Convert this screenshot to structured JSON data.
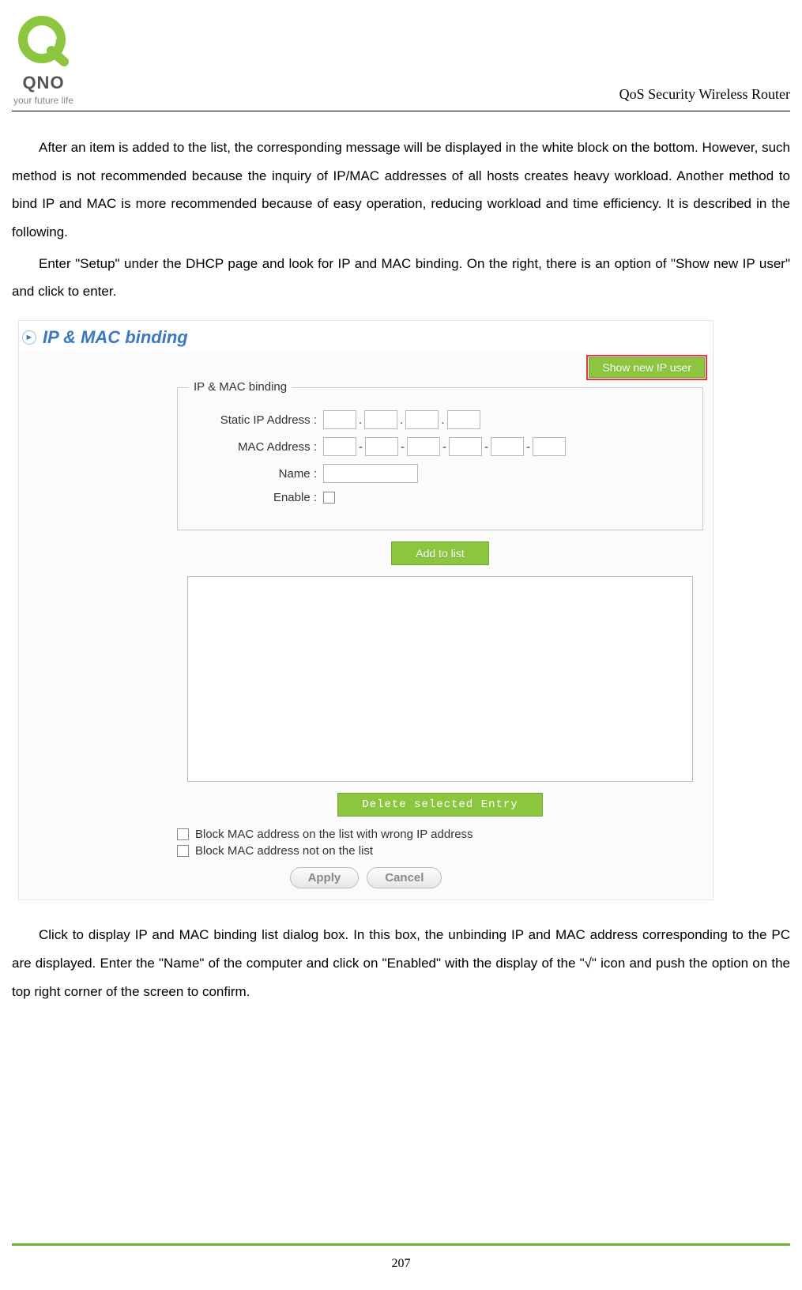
{
  "header": {
    "logo_brand": "QNO",
    "logo_tagline": "your future life",
    "doc_title": "QoS Security Wireless Router"
  },
  "paragraphs": {
    "p1": "After an item is added to the list, the corresponding message will be displayed in the white block on the bottom. However, such method is not recommended because the inquiry of IP/MAC addresses of all hosts creates heavy workload. Another method to bind IP and MAC is more recommended because of easy operation, reducing workload and time efficiency. It is described in the following.",
    "p2": "Enter \"Setup\" under the DHCP page and look for IP and MAC binding. On the right, there is an option of \"Show new IP user\" and click to enter.",
    "p3": "Click to display IP and MAC binding list dialog box. In this box, the unbinding IP and MAC address corresponding to the PC are displayed. Enter the \"Name\" of the computer and click on \"Enabled\" with the display of the \"√\" icon and push the option on the top right corner of the screen to confirm."
  },
  "ui": {
    "section_title": "IP & MAC binding",
    "show_new_ip_btn": "Show new IP user",
    "fieldset_legend": "IP & MAC binding",
    "labels": {
      "static_ip": "Static IP Address :",
      "mac": "MAC Address :",
      "name": "Name :",
      "enable": "Enable :"
    },
    "add_btn": "Add to list",
    "delete_btn": "Delete selected Entry",
    "opt1": "Block MAC address on the list with wrong IP address",
    "opt2": "Block MAC address not on the list",
    "apply_btn": "Apply",
    "cancel_btn": "Cancel"
  },
  "page_number": "207"
}
